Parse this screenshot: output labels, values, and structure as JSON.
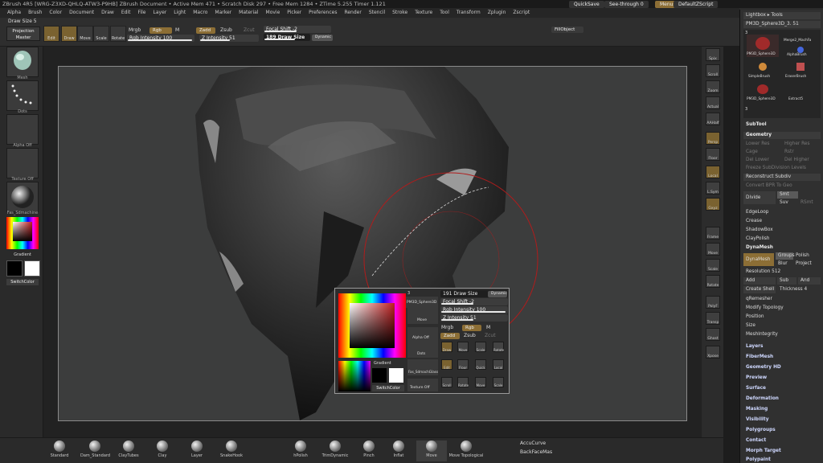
{
  "title_bar": "ZBrush 4R5 [WRG-Z3XD-QHLQ-ATW3-P9HB] ZBrush Document  • Active Mem 471 • Scratch Disk 297 • Free Mem 1284 • ZTime 5.255 Timer 1.121",
  "top_right": {
    "quicksave": "QuickSave",
    "seethrough": "See-through  0",
    "menus": "Menus",
    "script": "DefaultZScript"
  },
  "menu": [
    "Alpha",
    "Brush",
    "Color",
    "Document",
    "Draw",
    "Edit",
    "File",
    "Layer",
    "Light",
    "Macro",
    "Marker",
    "Material",
    "Movie",
    "Picker",
    "Preferences",
    "Render",
    "Stencil",
    "Stroke",
    "Texture",
    "Tool",
    "Transform",
    "Zplugin",
    "Zscript"
  ],
  "draw_size_label": "Draw Size  5",
  "toolbar": {
    "projection_master": "Projection Master",
    "edit": "Edit",
    "draw": "Draw",
    "move": "Move",
    "scale": "Scale",
    "rotate": "Rotate",
    "mrgb": "Mrgb",
    "rgb": "Rgb",
    "m": "M",
    "rgb_intensity": "Rgb Intensity 100",
    "zadd": "Zadd",
    "zsub": "Zsub",
    "zcut": "Zcut",
    "z_intensity": "Z Intensity 51",
    "focal_shift": "Focal Shift -2",
    "draw_size": "189 Draw Size",
    "dynamic": "Dynamic",
    "fill_object": "FillObject"
  },
  "left_tray": {
    "mesh": "Mesh",
    "dots": "Dots",
    "alpha_off": "Alpha Off",
    "texture_off": "Texture Off",
    "material": "Fas_Sdmachine",
    "gradient": "Gradient",
    "switch_color": "SwitchColor"
  },
  "right_shelf": [
    "Spix",
    "Scroll",
    "Zoom",
    "Actual",
    "AAHalf",
    "Persp",
    "Floor",
    "Local",
    "L.Sym",
    "Gxyz",
    "Frame",
    "Move",
    "Scale",
    "Rotate",
    "PolyF",
    "Transp",
    "Ghost",
    "Xpose"
  ],
  "right_panel": {
    "lightbox": "Lightbox ▸ Tools",
    "pm3d": "PM3D_Sphere3D_3. 51",
    "tool_thumbs": [
      "PM3D_Sphere3D",
      "Merge2_MachFa",
      "AlphaBrush",
      "SimpleBrush",
      "EraserBrush",
      "PM3D_Sphere3D",
      "Extract5"
    ],
    "count_a": "3",
    "count_b": "3",
    "subtool": "SubTool",
    "geometry": "Geometry",
    "dim_rows": [
      "Lower Res",
      "Higher Res",
      "Cage",
      "Rstr",
      "Del Lower",
      "Del Higher",
      "Freeze SubDivision Levels",
      "Convert BPR To Geo"
    ],
    "reconstruct": "Reconstruct Subdiv",
    "divide": "Divide",
    "smt": "Smt",
    "suv": "Suv",
    "rsmt": "RSmt",
    "items": [
      "EdgeLoop",
      "Crease",
      "ShadowBox",
      "ClayPolish",
      "DynaMesh"
    ],
    "dynamesh_btn": "DynaMesh",
    "groups": "Groups",
    "polish": "Polish",
    "blur": "Blur",
    "project": "Project",
    "resolution": "Resolution 512",
    "add": "Add",
    "sub": "Sub",
    "and": "And",
    "create_shell": "Create Shell",
    "thickness": "Thickness 4",
    "items2": [
      "qRemesher",
      "Modify Topology",
      "Position",
      "Size",
      "MeshIntegrity"
    ],
    "sections": [
      "Layers",
      "FiberMesh",
      "Geometry HD",
      "Preview",
      "Surface",
      "Deformation",
      "Masking",
      "Visibility",
      "Polygroups",
      "Contact",
      "Morph Target",
      "Polypaint"
    ]
  },
  "bottom_brushes": [
    "Standard",
    "Dam_Standard",
    "ClayTubes",
    "Clay",
    "Layer",
    "SnakeHook",
    "hPolish",
    "TrimDynamic",
    "Pinch",
    "Inflat",
    "Move",
    "Move Topological"
  ],
  "bottom_right": {
    "accucurve": "AccuCurve",
    "backfacemask": "BackFaceMas"
  },
  "popup": {
    "draw_size": "191 Draw Size",
    "dynamic": "Dynamic",
    "focal_shift": "Focal Shift -2",
    "rgb_intensity": "Rgb Intensity 100",
    "z_intensity": "Z Intensity 51",
    "mrgb": "Mrgb",
    "rgb": "Rgb",
    "m": "M",
    "zadd": "Zadd",
    "zsub": "Zsub",
    "zcut": "Zcut",
    "tool_name": "PM3D_Sphere3D",
    "move": "Move",
    "alpha_off": "Alpha Off",
    "dots": "Dots",
    "material": "Fas_SdmachGlass",
    "texture_off": "Texture Off",
    "gradient": "Gradient",
    "switch_color": "SwitchColor",
    "count": "3",
    "grid1": [
      "Draw",
      "Move",
      "Scale",
      "Rotate"
    ],
    "grid2": [
      "Edit",
      "Floor",
      "Quick",
      "Local"
    ],
    "grid3": [
      "Scroll",
      "Rotate",
      "Move",
      "Scale"
    ]
  },
  "colors": {
    "accent": "#8c6e35",
    "panel": "#303030",
    "canvas": "#3c3d3d"
  }
}
